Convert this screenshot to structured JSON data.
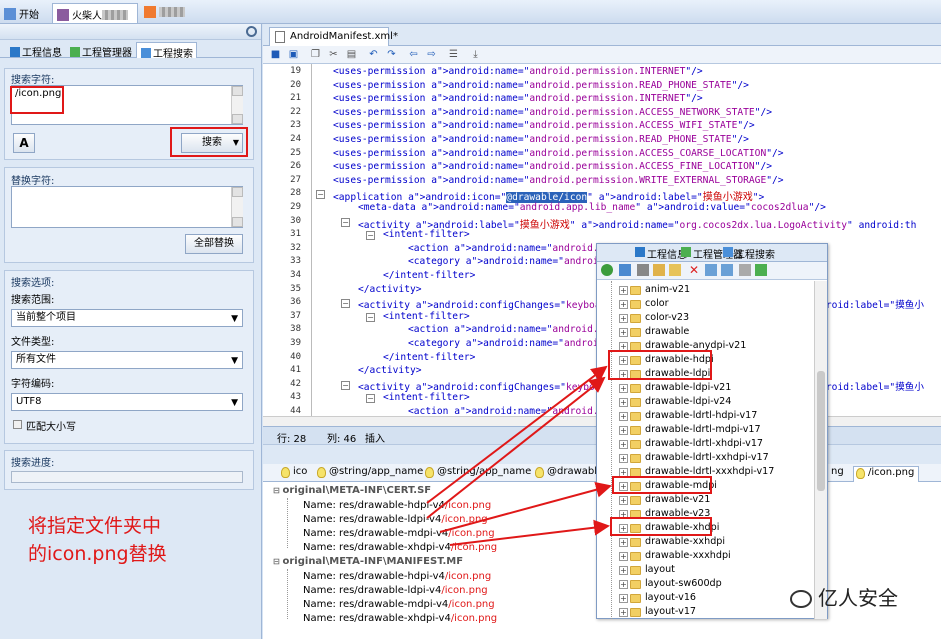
{
  "top_tabs": [
    {
      "label": "开始"
    },
    {
      "label": "火柴人"
    }
  ],
  "left_tabs": [
    "工程信息",
    "工程管理器",
    "工程搜索"
  ],
  "search": {
    "label": "搜索字符:",
    "value": "/icon.png",
    "button": "搜索"
  },
  "replace": {
    "label": "替换字符:",
    "value": "",
    "button": "全部替换"
  },
  "options": {
    "label": "搜索选项:",
    "scope_label": "搜索范围:",
    "scope_value": "当前整个项目",
    "filetype_label": "文件类型:",
    "filetype_value": "所有文件",
    "encoding_label": "字符编码:",
    "encoding_value": "UTF8",
    "case_label": "匹配大小写"
  },
  "progress": {
    "label": "搜索进度:",
    "value": 0
  },
  "editor": {
    "tab": "AndroidManifest.xml*",
    "status": {
      "line": "行: 28",
      "col": "列: 46",
      "mode": "插入"
    },
    "lines": [
      {
        "n": "19",
        "ind": 1,
        "t": "<uses-permission android:name=\"android.permission.INTERNET\"/>"
      },
      {
        "n": "20",
        "ind": 1,
        "t": "<uses-permission android:name=\"android.permission.READ_PHONE_STATE\"/>"
      },
      {
        "n": "21",
        "ind": 1,
        "t": "<uses-permission android:name=\"android.permission.INTERNET\"/>"
      },
      {
        "n": "22",
        "ind": 1,
        "t": "<uses-permission android:name=\"android.permission.ACCESS_NETWORK_STATE\"/>"
      },
      {
        "n": "23",
        "ind": 1,
        "t": "<uses-permission android:name=\"android.permission.ACCESS_WIFI_STATE\"/>"
      },
      {
        "n": "24",
        "ind": 1,
        "t": "<uses-permission android:name=\"android.permission.READ_PHONE_STATE\"/>"
      },
      {
        "n": "25",
        "ind": 1,
        "t": "<uses-permission android:name=\"android.permission.ACCESS_COARSE_LOCATION\"/>"
      },
      {
        "n": "26",
        "ind": 1,
        "t": "<uses-permission android:name=\"android.permission.ACCESS_FINE_LOCATION\"/>"
      },
      {
        "n": "27",
        "ind": 1,
        "t": "<uses-permission android:name=\"android.permission.WRITE_EXTERNAL_STORAGE\"/>"
      },
      {
        "n": "28",
        "ind": 1,
        "t": "<application android:icon=\"@drawable/icon\" android:label=\"摸鱼小游戏\">"
      },
      {
        "n": "29",
        "ind": 2,
        "t": "<meta-data android:name=\"android.app.lib_name\" android:value=\"cocos2dlua\"/>"
      },
      {
        "n": "30",
        "ind": 2,
        "t": "<activity android:label=\"摸鱼小游戏\" android:name=\"org.cocos2dx.lua.LogoActivity\" android:th"
      },
      {
        "n": "31",
        "ind": 3,
        "t": "<intent-filter>"
      },
      {
        "n": "32",
        "ind": 4,
        "t": "<action android:name=\"android.intent.action.MAIN\"/>"
      },
      {
        "n": "33",
        "ind": 4,
        "t": "<category android:name=\"android.intent.category.LAUNCHER\"/>"
      },
      {
        "n": "34",
        "ind": 3,
        "t": "</intent-filter>"
      },
      {
        "n": "35",
        "ind": 2,
        "t": "</activity>"
      },
      {
        "n": "36",
        "ind": 2,
        "t": "<activity android:configChanges=\"keyboardHidden|orientation|screenSize\" android:label=\"摸鱼小"
      },
      {
        "n": "37",
        "ind": 3,
        "t": "<intent-filter>"
      },
      {
        "n": "38",
        "ind": 4,
        "t": "<action android:name=\"android.intent.action.VIEW\"/>"
      },
      {
        "n": "39",
        "ind": 4,
        "t": "<category android:name=\"android.intent.category.DEFAULT\"/>"
      },
      {
        "n": "40",
        "ind": 3,
        "t": "</intent-filter>"
      },
      {
        "n": "41",
        "ind": 2,
        "t": "</activity>"
      },
      {
        "n": "42",
        "ind": 2,
        "t": "<activity android:configChanges=\"keyboardHidden|orientation|screenSize\" android:label=\"摸鱼小"
      },
      {
        "n": "43",
        "ind": 3,
        "t": "<intent-filter>"
      },
      {
        "n": "44",
        "ind": 4,
        "t": "<action android:name=\"android.intent.action.VIEW\"/>"
      }
    ]
  },
  "results_tabs": [
    "ico",
    "@string/app_name",
    "@string/app_name",
    "@drawabl",
    "ng",
    "/icon.png"
  ],
  "results": {
    "groups": [
      {
        "title": "original\\META-INF\\CERT.SF",
        "items": [
          {
            "prefix": "Name: res/drawable-hdpi-v4",
            "file": "/icon.png"
          },
          {
            "prefix": "Name: res/drawable-ldpi-v4",
            "file": "/icon.png"
          },
          {
            "prefix": "Name: res/drawable-mdpi-v4",
            "file": "/icon.png"
          },
          {
            "prefix": "Name: res/drawable-xhdpi-v4",
            "file": "/icon.png"
          }
        ]
      },
      {
        "title": "original\\META-INF\\MANIFEST.MF",
        "items": [
          {
            "prefix": "Name: res/drawable-hdpi-v4",
            "file": "/icon.png"
          },
          {
            "prefix": "Name: res/drawable-ldpi-v4",
            "file": "/icon.png"
          },
          {
            "prefix": "Name: res/drawable-mdpi-v4",
            "file": "/icon.png"
          },
          {
            "prefix": "Name: res/drawable-xhdpi-v4",
            "file": "/icon.png"
          }
        ]
      }
    ]
  },
  "popup": {
    "tabs": [
      "工程信息",
      "工程管理器",
      "工程搜索"
    ],
    "folders": [
      "anim-v21",
      "color",
      "color-v23",
      "drawable",
      "drawable-anydpi-v21",
      "drawable-hdpi",
      "drawable-ldpi",
      "drawable-ldpi-v21",
      "drawable-ldpi-v24",
      "drawable-ldrtl-hdpi-v17",
      "drawable-ldrtl-mdpi-v17",
      "drawable-ldrtl-xhdpi-v17",
      "drawable-ldrtl-xxhdpi-v17",
      "drawable-ldrtl-xxxhdpi-v17",
      "drawable-mdpi",
      "drawable-v21",
      "drawable-v23",
      "drawable-xhdpi",
      "drawable-xxhdpi",
      "drawable-xxxhdpi",
      "layout",
      "layout-sw600dp",
      "layout-v16",
      "layout-v17"
    ]
  },
  "annotation": [
    "将指定文件夹中",
    "的icon.png替换"
  ],
  "watermark": "亿人安全",
  "colors": {
    "annotation": "#e01818",
    "xml_tag": "#0000cc",
    "xml_attr": "#cc0000",
    "xml_value": "#990099"
  }
}
